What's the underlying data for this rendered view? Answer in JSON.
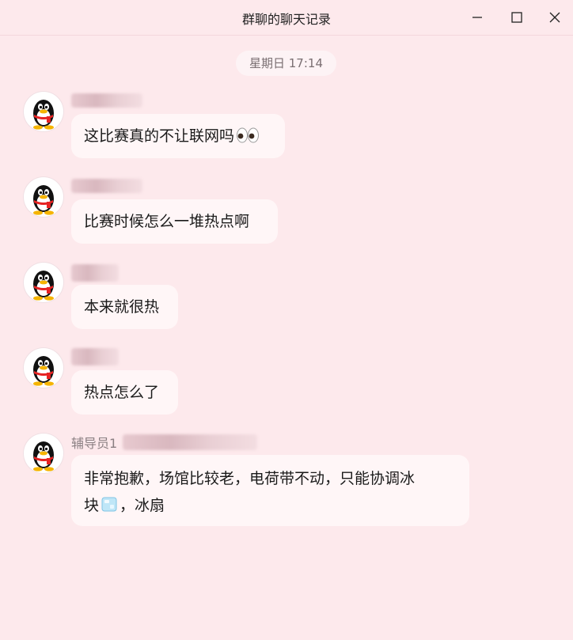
{
  "window": {
    "title": "群聊的聊天记录",
    "controls": [
      "minimize-icon",
      "maximize-icon",
      "close-icon"
    ]
  },
  "date_divider": "星期日 17:14",
  "messages": [
    {
      "sender": "",
      "text": "这比赛真的不让联网吗",
      "emoji": "eyes-emoji"
    },
    {
      "sender": "",
      "text": "比赛时候怎么一堆热点啊"
    },
    {
      "sender": "",
      "text": "本来就很热"
    },
    {
      "sender": "",
      "text": "热点怎么了"
    },
    {
      "sender": "辅导员1",
      "line1": "非常抱歉，场馆比较老，电荷带不动，只能协调冰",
      "line2_pre": "块",
      "line2_emoji": "ice-cube-emoji",
      "line2_post": "，冰扇"
    }
  ],
  "colors": {
    "background": "#fde9ec",
    "bubble": "#fff6f7",
    "text": "#1a1a1a",
    "muted": "#7a6f72"
  }
}
